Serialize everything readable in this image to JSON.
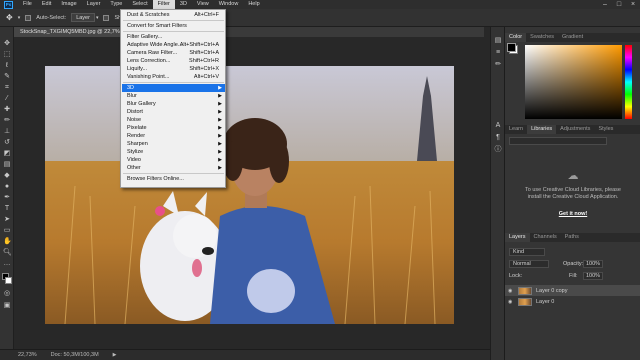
{
  "app": {
    "logo": "Ps"
  },
  "menubar": {
    "items": [
      "File",
      "Edit",
      "Image",
      "Layer",
      "Type",
      "Select",
      "Filter",
      "3D",
      "View",
      "Window",
      "Help"
    ],
    "active": "Filter"
  },
  "optionsbar": {
    "auto_select_label": "Auto-Select:",
    "auto_select_value": "Layer",
    "show_transform_label": "Show Tra"
  },
  "document": {
    "tab_title": "StockSnap_TXGIMQ5MBD.jpg @ 22,7% (Lay"
  },
  "status": {
    "zoom": "22,73%",
    "doc": "Doc: 50,3M/100,3M"
  },
  "filter_menu": {
    "items": [
      {
        "label": "Dust & Scratches",
        "shortcut": "Alt+Ctrl+F",
        "arrow": false
      },
      {
        "label": "Convert for Smart Filters",
        "shortcut": "",
        "arrow": false
      },
      {
        "label": "Filter Gallery...",
        "shortcut": "",
        "arrow": false
      },
      {
        "label": "Adaptive Wide Angle...",
        "shortcut": "Alt+Shift+Ctrl+A",
        "arrow": false
      },
      {
        "label": "Camera Raw Filter...",
        "shortcut": "Shift+Ctrl+A",
        "arrow": false
      },
      {
        "label": "Lens Correction...",
        "shortcut": "Shift+Ctrl+R",
        "arrow": false
      },
      {
        "label": "Liquify...",
        "shortcut": "Shift+Ctrl+X",
        "arrow": false
      },
      {
        "label": "Vanishing Point...",
        "shortcut": "Alt+Ctrl+V",
        "arrow": false
      },
      {
        "label": "3D",
        "shortcut": "",
        "arrow": true,
        "highlighted": true
      },
      {
        "label": "Blur",
        "shortcut": "",
        "arrow": true
      },
      {
        "label": "Blur Gallery",
        "shortcut": "",
        "arrow": true
      },
      {
        "label": "Distort",
        "shortcut": "",
        "arrow": true
      },
      {
        "label": "Noise",
        "shortcut": "",
        "arrow": true
      },
      {
        "label": "Pixelate",
        "shortcut": "",
        "arrow": true
      },
      {
        "label": "Render",
        "shortcut": "",
        "arrow": true
      },
      {
        "label": "Sharpen",
        "shortcut": "",
        "arrow": true
      },
      {
        "label": "Stylize",
        "shortcut": "",
        "arrow": true
      },
      {
        "label": "Video",
        "shortcut": "",
        "arrow": true
      },
      {
        "label": "Other",
        "shortcut": "",
        "arrow": true
      },
      {
        "label": "Browse Filters Online...",
        "shortcut": "",
        "arrow": false
      }
    ]
  },
  "color_panel": {
    "tabs": [
      "Color",
      "Swatches",
      "Gradient"
    ],
    "active": "Color"
  },
  "libraries_panel": {
    "tabs": [
      "Learn",
      "Libraries",
      "Adjustments",
      "Styles"
    ],
    "active": "Libraries",
    "message": "To use Creative Cloud Libraries, please install the Creative Cloud Application.",
    "link": "Get it now!"
  },
  "layers_panel": {
    "tabs": [
      "Layers",
      "Channels",
      "Paths"
    ],
    "active": "Layers",
    "kind_label": "Kind",
    "blend_mode": "Normal",
    "opacity_label": "Opacity:",
    "opacity_value": "100%",
    "lock_label": "Lock:",
    "fill_label": "Fill:",
    "fill_value": "100%",
    "layers": [
      {
        "name": "Layer 0 copy",
        "selected": true
      },
      {
        "name": "Layer 0",
        "selected": false
      }
    ]
  },
  "colors": {
    "accent": "#1a73e8",
    "menubar": "#2e2e2e",
    "panel": "#353535",
    "canvas_bg": "#282828"
  }
}
